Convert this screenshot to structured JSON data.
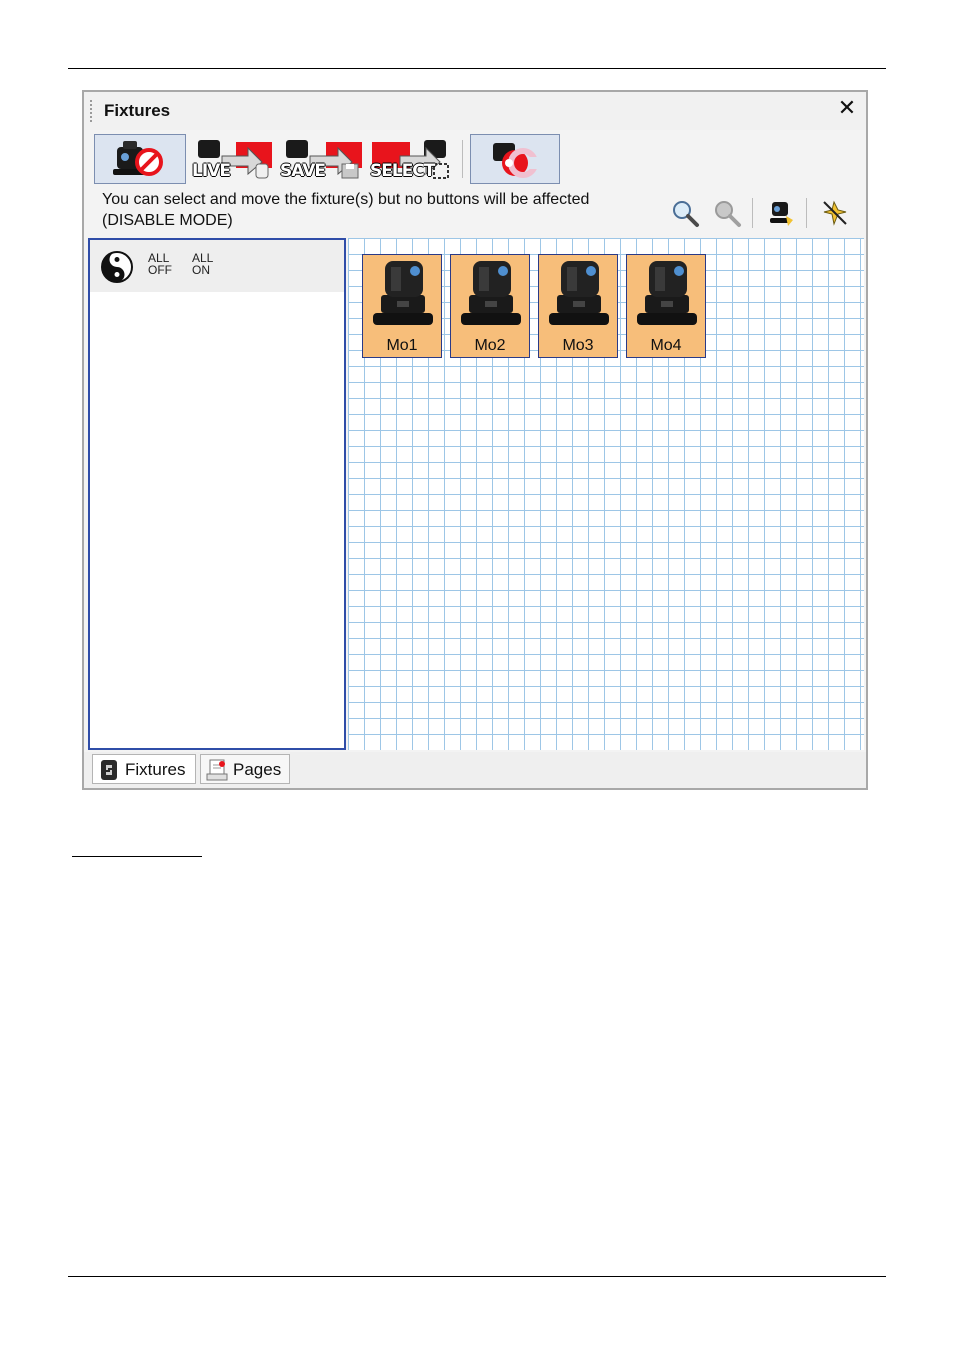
{
  "window": {
    "title": "Fixtures",
    "close_symbol": "✕"
  },
  "toolbar": {
    "buttons": [
      {
        "name": "disable-mode",
        "icon": "disable-icon",
        "label": ""
      },
      {
        "name": "live-mode",
        "icon": "live-mode-icon",
        "label": "LIVE"
      },
      {
        "name": "save-mode",
        "icon": "save-mode-icon",
        "label": "SAVE"
      },
      {
        "name": "select-mode",
        "icon": "select-mode-icon",
        "label": "SELECT"
      },
      {
        "name": "magnet",
        "icon": "magnet-icon",
        "label": ""
      }
    ]
  },
  "info": {
    "line1": "You can select and move the fixture(s) but no buttons will be affected",
    "line2": "(DISABLE MODE)"
  },
  "tools": [
    "zoom-in-icon",
    "zoom-out-icon",
    "fixture-tool-icon",
    "pin-icon"
  ],
  "groups": {
    "all_off_line1": "ALL",
    "all_off_line2": "OFF",
    "all_on_line1": "ALL",
    "all_on_line2": "ON"
  },
  "fixtures": [
    {
      "label": "Mo1"
    },
    {
      "label": "Mo2"
    },
    {
      "label": "Mo3"
    },
    {
      "label": "Mo4"
    }
  ],
  "tabs": [
    {
      "label": "Fixtures",
      "icon": "fixtures-tab-icon",
      "active": true
    },
    {
      "label": "Pages",
      "icon": "pages-tab-icon",
      "active": false
    }
  ],
  "colors": {
    "fixture_fill": "#f7be7a",
    "selection_border": "#2f4da8",
    "grid_line": "#9dc6e6",
    "accent_red": "#e8141c"
  }
}
